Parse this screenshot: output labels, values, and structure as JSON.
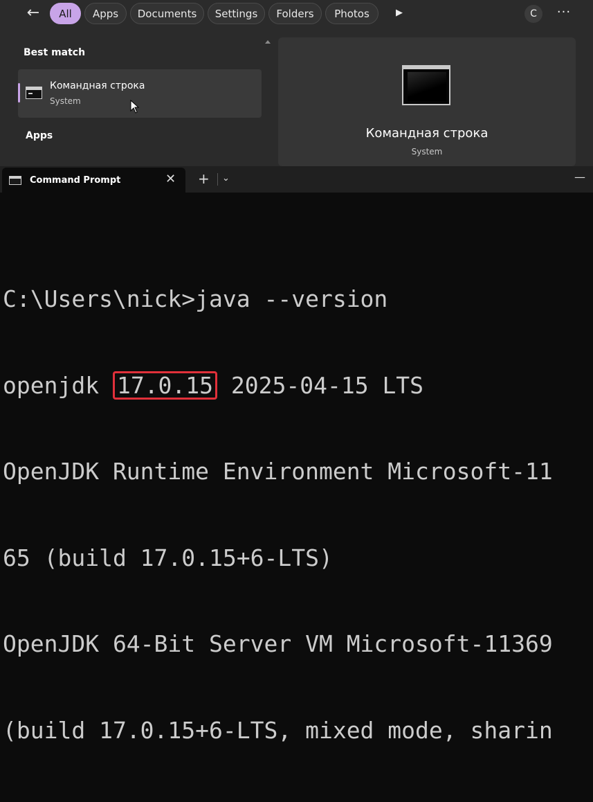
{
  "search": {
    "back_label": "←",
    "filters": [
      "All",
      "Apps",
      "Documents",
      "Settings",
      "Folders",
      "Photos"
    ],
    "active_filter": "All",
    "play_label": "▶",
    "avatar_letter": "C",
    "more_label": "···",
    "best_match_label": "Best match",
    "best_match": {
      "title": "Командная строка",
      "subtitle": "System"
    },
    "apps_label": "Apps",
    "preview": {
      "title": "Командная строка",
      "subtitle": "System"
    }
  },
  "terminal": {
    "tab_title": "Command Prompt",
    "tab_close": "✕",
    "new_tab": "+",
    "dropdown": "⌄",
    "minimize": "—",
    "lines": [
      "C:\\Users\\nick>java --version",
      "openjdk 17.0.15 2025-04-15 LTS",
      "OpenJDK Runtime Environment Microsoft-11",
      "65 (build 17.0.15+6-LTS)",
      "OpenJDK 64-Bit Server VM Microsoft-11369",
      "(build 17.0.15+6-LTS, mixed mode, sharin"
    ],
    "line2_prefix": "openjdk ",
    "highlight_version": "17.0.15",
    "line2_suffix": " 2025-04-15 LTS",
    "highlight_color": "#e0303a"
  },
  "colors": {
    "accent": "#c8a4e8",
    "search_bg": "#2b2b2b",
    "terminal_bg": "#0c0c0c",
    "terminal_text": "#cccccc"
  }
}
